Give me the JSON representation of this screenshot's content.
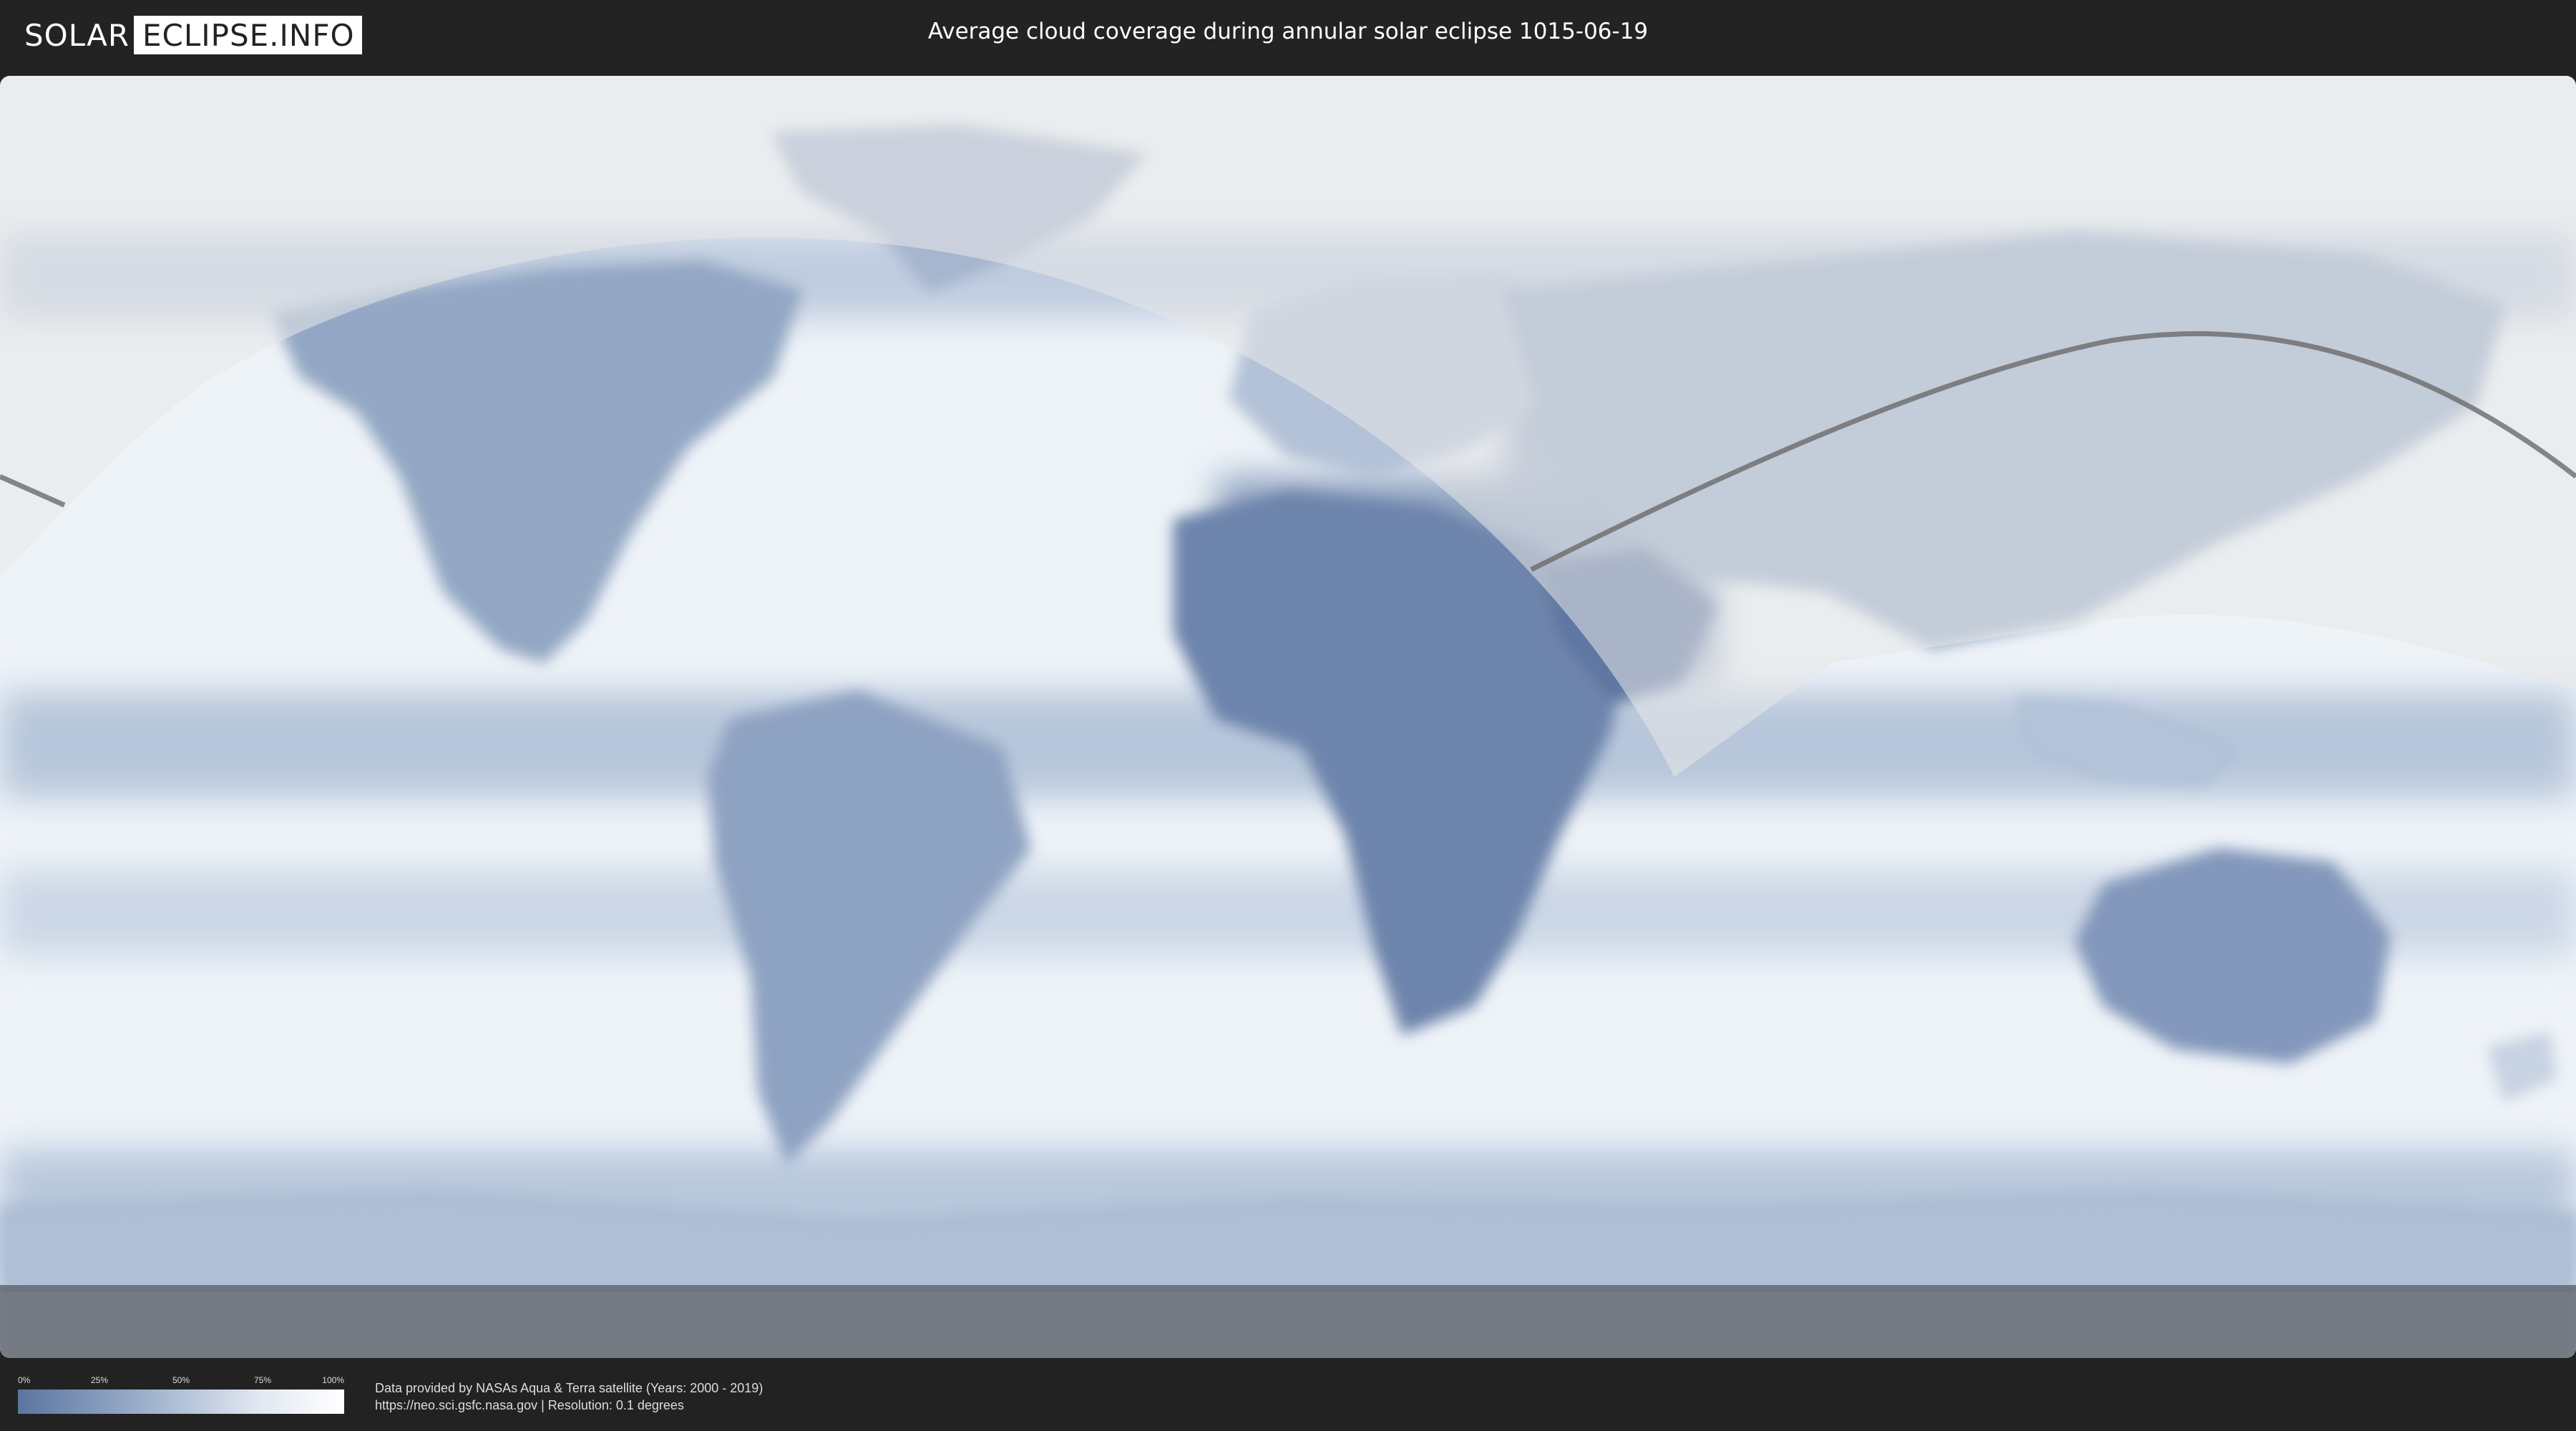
{
  "header": {
    "logo_left": "SOLAR",
    "logo_right": "ECLIPSE.INFO",
    "title": "Average cloud coverage during annular solar eclipse 1015-06-19"
  },
  "legend": {
    "ticks": [
      "0%",
      "25%",
      "50%",
      "75%",
      "100%"
    ],
    "low_color": "#5b74a0",
    "high_color": "#ffffff"
  },
  "footer": {
    "credit_line1": "Data provided by NASAs Aqua & Terra satellite (Years: 2000 - 2019)",
    "credit_line2": "https://neo.sci.gsfc.nasa.gov | Resolution: 0.1 degrees"
  },
  "map": {
    "colors": {
      "ocean_clear": "#eef3f8",
      "cloud_low": "#5b74a0",
      "penumbra_overlay": "#e8e8e8",
      "eclipse_path": "#6a6a6a",
      "coastline": "#8a9bb3"
    }
  }
}
